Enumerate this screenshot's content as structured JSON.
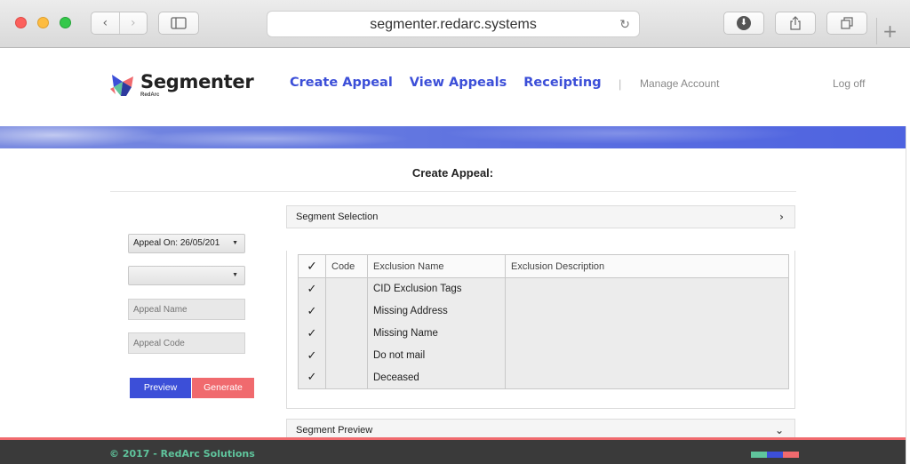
{
  "browser": {
    "url": "segmenter.redarc.systems",
    "back_glyph": "‹",
    "forward_glyph": "›",
    "reload_glyph": "↻",
    "download_glyph": "⬇",
    "share_glyph": "⇪",
    "tabs_glyph": "❐",
    "newtab_glyph": "+"
  },
  "header": {
    "logo_text": "Segmenter",
    "logo_sub": "RedArc",
    "nav": [
      "Create Appeal",
      "View Appeals",
      "Receipting"
    ],
    "separator": "|",
    "manage_account": "Manage Account",
    "log_off": "Log off"
  },
  "page": {
    "title": "Create Appeal:"
  },
  "form": {
    "appeal_on": "Appeal On: 26/05/201",
    "second_select": "",
    "caret": "▼",
    "appeal_name_placeholder": "Appeal Name",
    "appeal_code_placeholder": "Appeal Code",
    "preview_label": "Preview",
    "generate_label": "Generate"
  },
  "segment_selection": {
    "label": "Segment Selection",
    "chevron": "›"
  },
  "exclusions": {
    "columns": [
      "✓",
      "Code",
      "Exclusion Name",
      "Exclusion Description"
    ],
    "rows": [
      {
        "check": "✓",
        "code": "",
        "name": "CID Exclusion Tags",
        "description": ""
      },
      {
        "check": "✓",
        "code": "",
        "name": "Missing Address",
        "description": ""
      },
      {
        "check": "✓",
        "code": "",
        "name": "Missing Name",
        "description": ""
      },
      {
        "check": "✓",
        "code": "",
        "name": "Do not mail",
        "description": ""
      },
      {
        "check": "✓",
        "code": "",
        "name": "Deceased",
        "description": ""
      }
    ]
  },
  "segment_preview": {
    "label": "Segment Preview",
    "chevron": "⌄"
  },
  "footer": {
    "copyright": "© 2017 - RedArc Solutions",
    "bar_colors": [
      "#5fc49c",
      "#3c4fd8",
      "#f06a6e"
    ]
  },
  "colors": {
    "accent": "#3c4fd8",
    "generate": "#f06a6e",
    "footer_bg": "#3a3a3a",
    "footer_text": "#5fc49c"
  }
}
